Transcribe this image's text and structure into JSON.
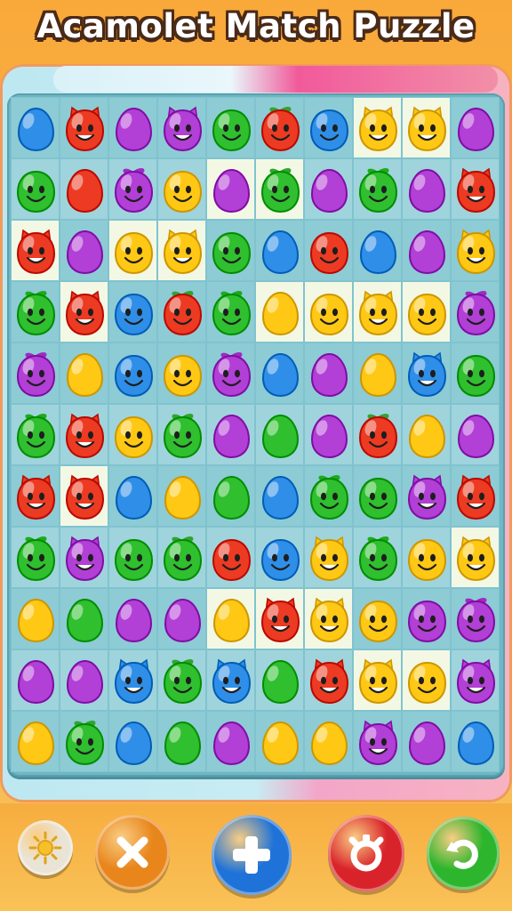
{
  "title": "Acamolet Match Puzzle",
  "board": {
    "rows": [
      [
        "blue-egg",
        "red-cat",
        "purple-egg",
        "purple-cat",
        "green-smile",
        "red-apple",
        "blue-smile",
        "yellow-cat",
        "yellow-cat",
        "purple-egg"
      ],
      [
        "green-smile",
        "red-egg",
        "purple-berry",
        "yellow-smile",
        "purple-egg",
        "green-apple",
        "purple-egg",
        "green-berry",
        "purple-egg",
        "red-cat"
      ],
      [
        "red-cat",
        "purple-egg",
        "yellow-smile",
        "yellow-cat",
        "green-smile",
        "blue-egg",
        "red-smile",
        "blue-egg",
        "purple-egg",
        "yellow-cat"
      ],
      [
        "green-berry",
        "red-cat",
        "blue-smile",
        "red-apple",
        "green-berry",
        "yellow-egg",
        "yellow-smile",
        "yellow-cat",
        "yellow-smile",
        "purple-berry"
      ],
      [
        "purple-berry",
        "yellow-egg",
        "blue-smile",
        "yellow-smile",
        "purple-berry",
        "blue-egg",
        "purple-egg",
        "yellow-egg",
        "blue-cat",
        "green-smile"
      ],
      [
        "green-berry",
        "red-cat",
        "yellow-smile",
        "green-apple",
        "purple-egg",
        "green-egg",
        "purple-egg",
        "red-apple",
        "yellow-egg",
        "purple-egg"
      ],
      [
        "red-cat",
        "red-cat",
        "blue-egg",
        "yellow-egg",
        "green-egg",
        "blue-egg",
        "green-berry",
        "green-smile",
        "purple-cat",
        "red-cat"
      ],
      [
        "green-berry",
        "purple-cat",
        "green-smile",
        "green-apple",
        "red-smile",
        "blue-smile",
        "yellow-cat",
        "green-berry",
        "yellow-smile",
        "yellow-cat"
      ],
      [
        "yellow-egg",
        "green-egg",
        "purple-egg",
        "purple-egg",
        "yellow-egg",
        "red-cat",
        "yellow-cat",
        "yellow-smile",
        "purple-smile",
        "purple-berry"
      ],
      [
        "purple-egg",
        "purple-egg",
        "blue-cat",
        "green-apple",
        "blue-cat",
        "green-egg",
        "red-cat",
        "yellow-cat",
        "yellow-smile",
        "purple-cat"
      ],
      [
        "yellow-egg",
        "green-apple",
        "blue-egg",
        "green-egg",
        "purple-egg",
        "yellow-egg",
        "yellow-egg",
        "purple-cat",
        "purple-egg",
        "blue-egg"
      ]
    ],
    "tiles": [
      [
        0,
        0,
        0,
        0,
        0,
        0,
        0,
        2,
        2,
        0
      ],
      [
        1,
        1,
        1,
        1,
        2,
        2,
        1,
        1,
        1,
        1
      ],
      [
        2,
        0,
        2,
        2,
        0,
        0,
        0,
        0,
        0,
        0
      ],
      [
        0,
        2,
        0,
        0,
        0,
        2,
        2,
        2,
        2,
        0
      ],
      [
        0,
        0,
        0,
        0,
        0,
        0,
        0,
        0,
        0,
        0
      ],
      [
        1,
        1,
        1,
        1,
        1,
        1,
        1,
        1,
        1,
        1
      ],
      [
        0,
        2,
        0,
        0,
        0,
        0,
        0,
        0,
        0,
        0
      ],
      [
        1,
        1,
        1,
        1,
        1,
        1,
        1,
        1,
        1,
        2
      ],
      [
        0,
        0,
        0,
        0,
        2,
        2,
        2,
        0,
        0,
        0
      ],
      [
        1,
        1,
        1,
        1,
        1,
        1,
        1,
        2,
        2,
        1
      ],
      [
        0,
        0,
        0,
        0,
        0,
        0,
        0,
        0,
        0,
        0
      ]
    ]
  },
  "colors": {
    "blue": "#2f8fe8",
    "red": "#ec3b22",
    "purple": "#b23fd6",
    "green": "#2fbf2f",
    "yellow": "#ffc814"
  },
  "controls": [
    {
      "icon": "sun-icon",
      "color": "#e9e4d6"
    },
    {
      "icon": "close-icon",
      "color": "#e8861c"
    },
    {
      "icon": "plus-icon",
      "color": "#1f73d8"
    },
    {
      "icon": "alarm-icon",
      "color": "#d9232a"
    },
    {
      "icon": "refresh-icon",
      "color": "#2db52d"
    }
  ]
}
